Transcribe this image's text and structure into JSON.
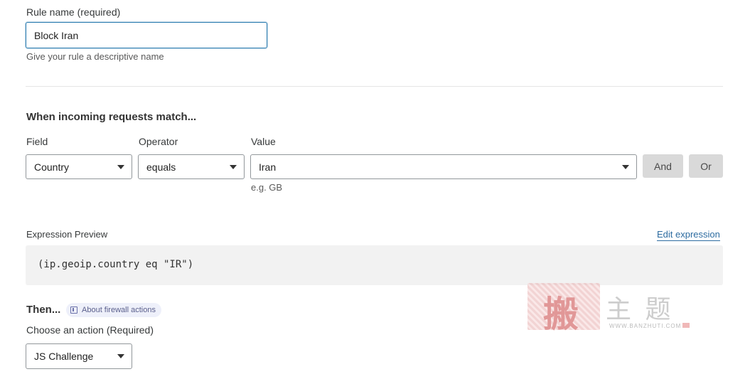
{
  "rule_name": {
    "label": "Rule name (required)",
    "value": "Block Iran",
    "help": "Give your rule a descriptive name"
  },
  "match": {
    "heading": "When incoming requests match...",
    "field_label": "Field",
    "operator_label": "Operator",
    "value_label": "Value",
    "field_value": "Country",
    "operator_value": "equals",
    "value_value": "Iran",
    "value_hint": "e.g. GB",
    "and_label": "And",
    "or_label": "Or"
  },
  "expression": {
    "label": "Expression Preview",
    "edit_link": "Edit expression",
    "code": "(ip.geoip.country eq \"IR\")"
  },
  "action": {
    "heading": "Then...",
    "about_link": "About firewall actions",
    "label": "Choose an action (Required)",
    "value": "JS Challenge"
  },
  "watermark": {
    "chars": "主 题",
    "url": "WWW.BANZHUTI.COM"
  },
  "colors": {
    "focus_border": "#2c7cb0",
    "link": "#2c6ba0",
    "button_bg": "#d9d9d9",
    "code_bg": "#f2f2f2",
    "watermark_red": "#d44a4a"
  },
  "icons": {
    "select_caret": "caret-down-icon",
    "book": "book-icon"
  }
}
